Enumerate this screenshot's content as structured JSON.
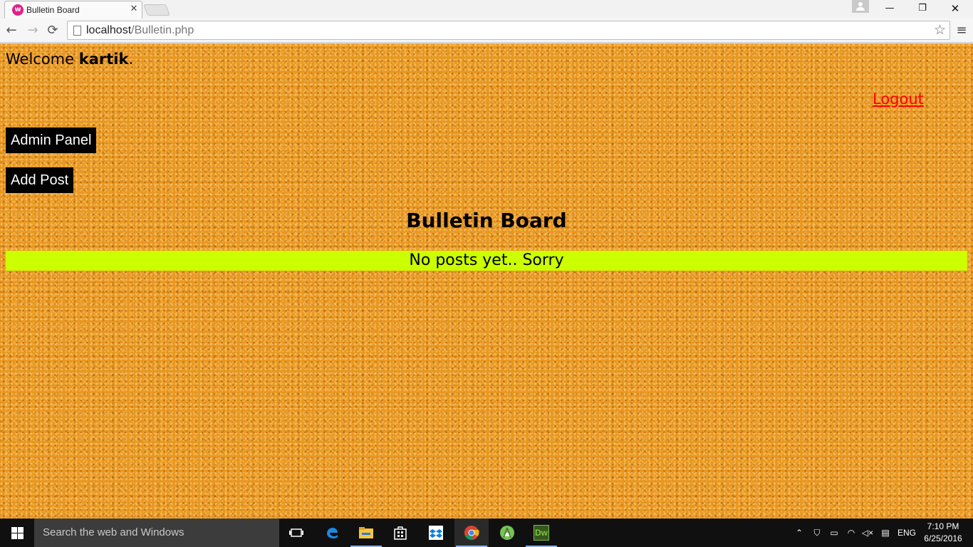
{
  "browser": {
    "tab_title": "Bulletin Board",
    "tab_favicon_letter": "w",
    "close_glyph": "✕",
    "url_host": "localhost",
    "url_path": "/Bulletin.php",
    "window_controls": {
      "minimize": "—",
      "maximize": "❐",
      "close": "✕"
    },
    "nav": {
      "back": "←",
      "forward": "→",
      "reload": "⟳",
      "bookmark_star": "☆",
      "menu": "≡"
    }
  },
  "page": {
    "welcome_prefix": "Welcome ",
    "username": "kartik",
    "welcome_suffix": ".",
    "logout_label": "Logout",
    "admin_panel_label": "Admin Panel",
    "add_post_label": "Add Post",
    "board_title": "Bulletin Board",
    "no_posts_message": "No posts yet.. Sorry",
    "colors": {
      "cork_background": "#e8961e",
      "logout_link": "#ff0000",
      "button_bg": "#000000",
      "no_posts_bar": "#ccff00"
    }
  },
  "taskbar": {
    "search_placeholder": "Search the web and Windows",
    "pinned_icons": [
      "task-view-icon",
      "edge-icon",
      "file-explorer-icon",
      "store-icon",
      "dropbox-icon",
      "chrome-icon",
      "android-studio-icon",
      "dreamweaver-icon"
    ],
    "dreamweaver_label": "Dw",
    "tray": {
      "language": "ENG",
      "time": "7:10 PM",
      "date": "6/25/2016"
    }
  }
}
